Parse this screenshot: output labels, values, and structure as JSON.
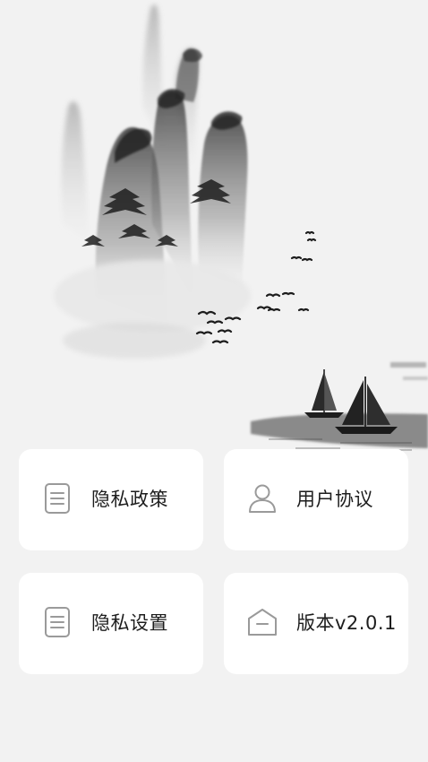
{
  "menu": {
    "items": [
      {
        "label": "隐私政策",
        "icon": "document-icon"
      },
      {
        "label": "用户协议",
        "icon": "user-icon"
      },
      {
        "label": "隐私设置",
        "icon": "document-icon"
      },
      {
        "label": "版本v2.0.1",
        "icon": "box-icon"
      }
    ]
  },
  "colors": {
    "background": "#f2f2f2",
    "card": "#ffffff",
    "text": "#1d1d1d",
    "icon_stroke": "#9a9a9a",
    "ink": "#2a2a2a"
  }
}
